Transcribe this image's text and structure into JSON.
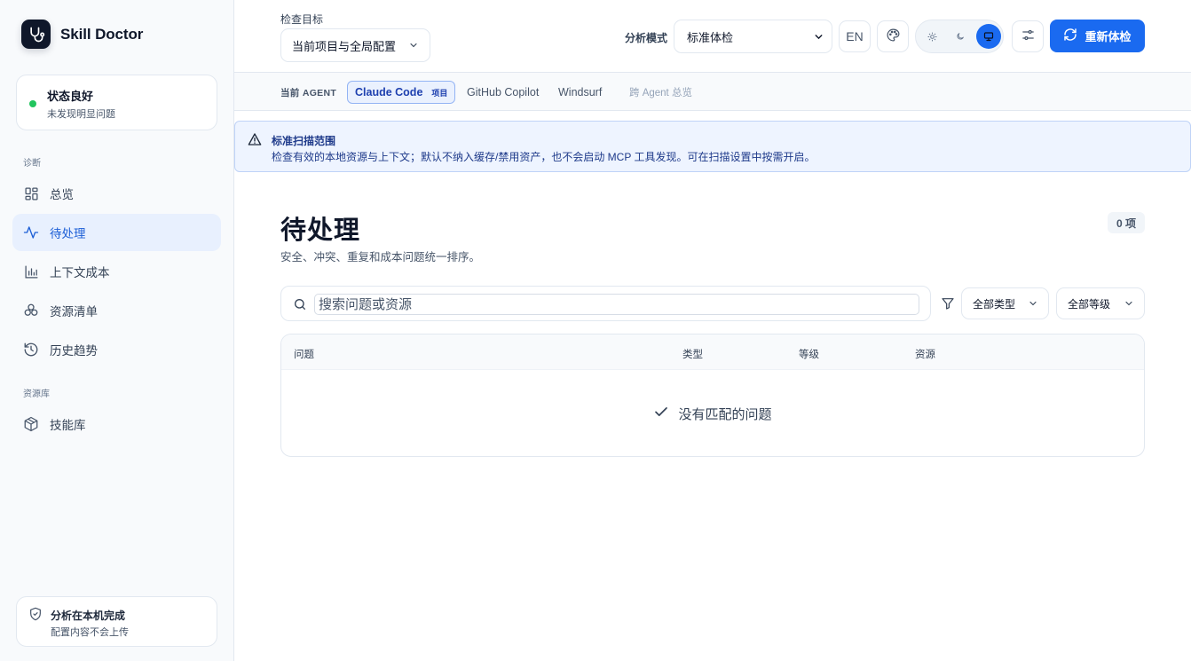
{
  "app": {
    "name": "Skill Doctor"
  },
  "status": {
    "title": "状态良好",
    "subtitle": "未发现明显问题",
    "color": "#22c55e"
  },
  "sidebar": {
    "groups": [
      {
        "label": "诊断",
        "items": [
          {
            "label": "总览",
            "icon": "grid-icon",
            "active": false
          },
          {
            "label": "待处理",
            "icon": "activity-icon",
            "active": true
          },
          {
            "label": "上下文成本",
            "icon": "bar-chart-icon",
            "active": false
          },
          {
            "label": "资源清单",
            "icon": "boxes-icon",
            "active": false
          },
          {
            "label": "历史趋势",
            "icon": "history-icon",
            "active": false
          }
        ]
      },
      {
        "label": "资源库",
        "items": [
          {
            "label": "技能库",
            "icon": "package-icon",
            "active": false
          }
        ]
      }
    ]
  },
  "privacy": {
    "title": "分析在本机完成",
    "subtitle": "配置内容不会上传"
  },
  "topbar": {
    "target_label": "检查目标",
    "target_value": "当前项目与全局配置",
    "mode_label": "分析模式",
    "mode_value": "标准体检",
    "lang": "EN",
    "theme_options": [
      "sun-icon",
      "moon-icon",
      "monitor-icon"
    ],
    "theme_active": "monitor-icon",
    "rescan_label": "重新体检",
    "accent": "#1a6af0"
  },
  "agents": {
    "label": "当前 AGENT",
    "tabs": [
      {
        "label": "Claude Code",
        "badge": "项目",
        "active": true
      },
      {
        "label": "GitHub Copilot",
        "active": false
      },
      {
        "label": "Windsurf",
        "active": false
      },
      {
        "label": "跨 Agent 总览",
        "active": false,
        "muted": true
      }
    ]
  },
  "notice": {
    "title": "标准扫描范围",
    "text": "检查有效的本地资源与上下文；默认不纳入缓存/禁用资产，也不会启动 MCP 工具发现。可在扫描设置中按需开启。"
  },
  "main": {
    "title": "待处理",
    "subtitle": "安全、冲突、重复和成本问题统一排序。",
    "count": "0 项",
    "search_placeholder": "搜索问题或资源",
    "filter_type": "全部类型",
    "filter_level": "全部等级",
    "columns": [
      "问题",
      "类型",
      "等级",
      "资源"
    ],
    "empty_text": "没有匹配的问题"
  }
}
